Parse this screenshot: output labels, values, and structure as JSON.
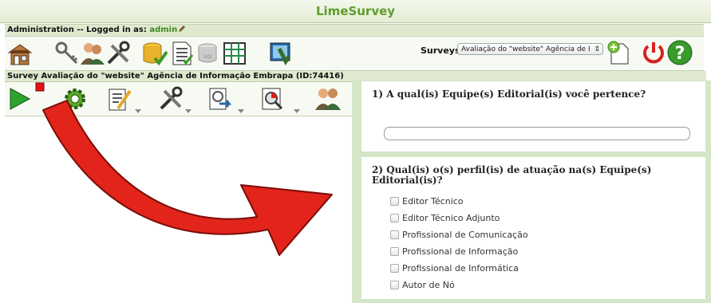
{
  "header": {
    "title": "LimeSurvey"
  },
  "admin_bar": {
    "prefix": "Administration -- Logged in as: ",
    "user": "admin"
  },
  "surveys_selector": {
    "label": "Surveys:",
    "selected": "Avaliação do \"website\" Agência de I"
  },
  "survey_bar": {
    "text": "Survey Avaliação do \"website\" Agência de Informação Embrapa (ID:74416)"
  },
  "question1": {
    "title": "1) A qual(is) Equipe(s) Editorial(is) você pertence?",
    "answer": ""
  },
  "question2": {
    "title": "2) Qual(is) o(s) perfil(is) de atuação na(s) Equipe(s) Editorial(is)?",
    "options": [
      "Editor Técnico",
      "Editor Técnico Adjunto",
      "Profissional de Comunicação",
      "Profissional de Informação",
      "Profissional de Informática",
      "Autor de Nó"
    ]
  },
  "colors": {
    "brand_green": "#5f9c2e",
    "bar_green": "#dfe9cf",
    "panel_green": "#d3e6c8",
    "arrow_red": "#e2241b"
  }
}
